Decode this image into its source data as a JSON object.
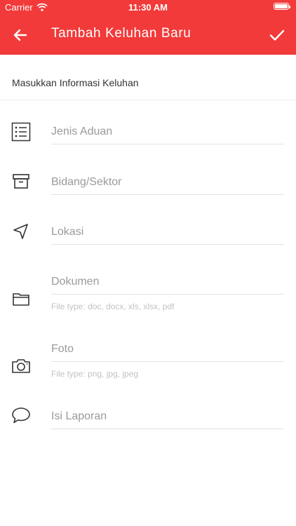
{
  "status_bar": {
    "carrier": "Carrier",
    "time": "11:30 AM"
  },
  "header": {
    "title": "Tambah Keluhan Baru",
    "back_icon": "arrow-left-icon",
    "confirm_icon": "check-icon"
  },
  "section_title": "Masukkan Informasi Keluhan",
  "fields": {
    "jenis": {
      "placeholder": "Jenis Aduan",
      "icon": "list-icon"
    },
    "bidang": {
      "placeholder": "Bidang/Sektor",
      "icon": "archive-icon"
    },
    "lokasi": {
      "placeholder": "Lokasi",
      "icon": "navigation-icon"
    },
    "dokumen": {
      "placeholder": "Dokumen",
      "hint": "File type: doc, docx, xls, xlsx, pdf",
      "icon": "folder-icon"
    },
    "foto": {
      "placeholder": "Foto",
      "hint": "File type: png, jpg, jpeg",
      "icon": "camera-icon"
    },
    "laporan": {
      "placeholder": "Isi Laporan",
      "icon": "speech-bubble-icon"
    }
  },
  "colors": {
    "primary": "#f23a3a",
    "placeholder": "#9a9a9a",
    "hint": "#c2c2c2",
    "icon": "#333333"
  }
}
